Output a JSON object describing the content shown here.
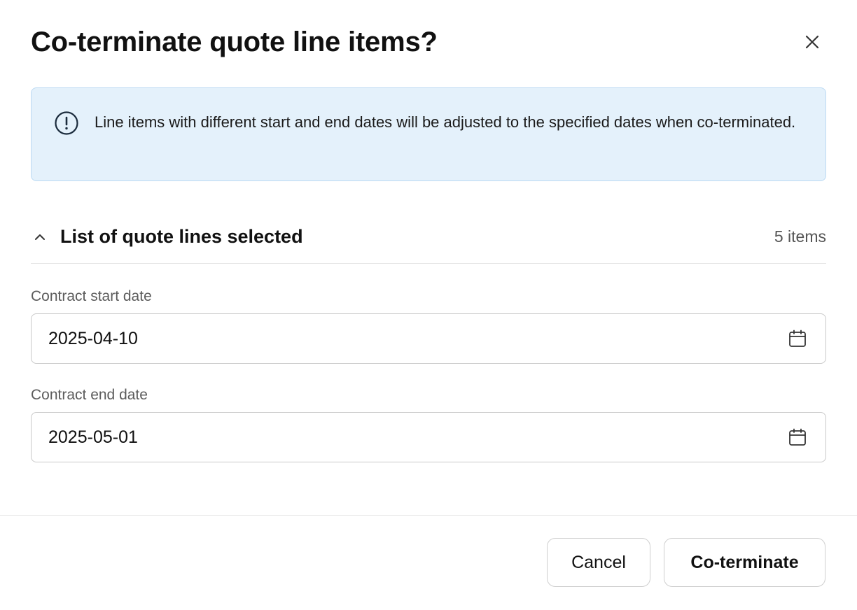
{
  "dialog": {
    "title": "Co-terminate quote line items?",
    "close_icon": "close-icon"
  },
  "banner": {
    "icon": "info-icon",
    "message": "Line items with different start and end dates will be adjusted to the specified dates when co-terminated.",
    "background": "#e4f1fb",
    "border": "#bcdaf3"
  },
  "section": {
    "icon": "chevron-up-icon",
    "title": "List of quote lines selected",
    "count": "5 items",
    "expanded": true
  },
  "fields": {
    "start": {
      "label": "Contract start date",
      "value": "2025-04-10",
      "icon": "calendar-icon"
    },
    "end": {
      "label": "Contract end date",
      "value": "2025-05-01",
      "icon": "calendar-icon"
    }
  },
  "footer": {
    "cancel_label": "Cancel",
    "confirm_label": "Co-terminate"
  }
}
